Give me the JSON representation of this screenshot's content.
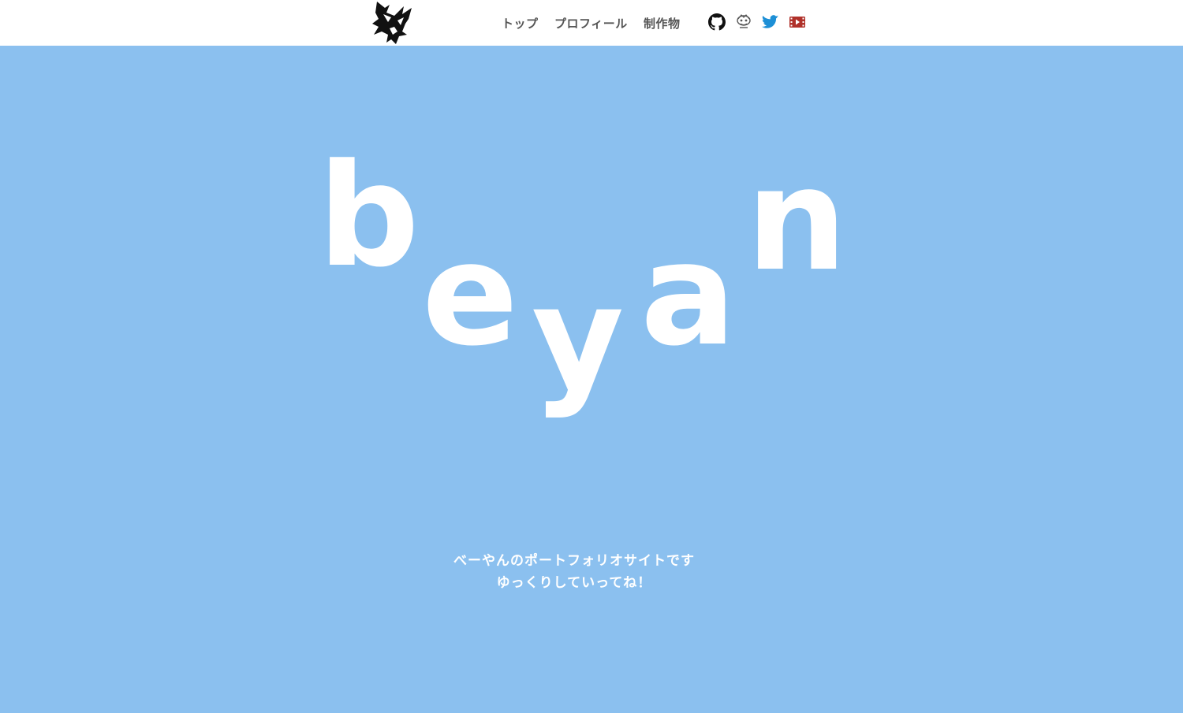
{
  "header": {
    "logo_name": "wolf-logo",
    "nav": [
      {
        "label": "トップ"
      },
      {
        "label": "プロフィール"
      },
      {
        "label": "制作物"
      }
    ],
    "social": [
      {
        "icon": "github-icon",
        "color": "#111111"
      },
      {
        "icon": "mascot-icon",
        "color": "#555555"
      },
      {
        "icon": "twitter-icon",
        "color": "#1d8fd6"
      },
      {
        "icon": "video-icon",
        "color": "#b0312a"
      }
    ]
  },
  "hero": {
    "letters": [
      "b",
      "e",
      "y",
      "a",
      "n"
    ],
    "tagline_line1": "べーやんのポートフォリオサイトです",
    "tagline_line2": "ゆっくりしていってね！"
  },
  "colors": {
    "background": "#8bc0ef",
    "header_bg": "#ffffff",
    "text_white": "#ffffff",
    "nav_text": "#555555"
  }
}
